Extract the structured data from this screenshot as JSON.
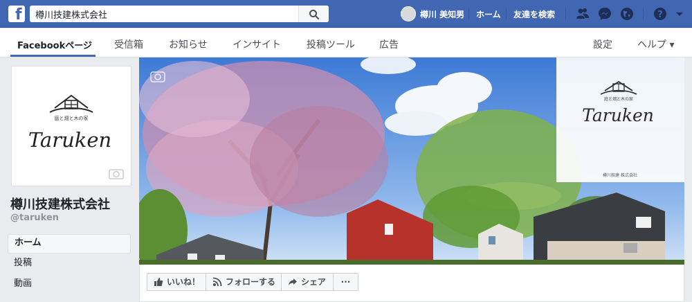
{
  "topbar": {
    "logo": "f",
    "search": {
      "value": "樽川技建株式会社",
      "placeholder": ""
    },
    "profile_name": "樽川 美知男",
    "home_label": "ホーム",
    "find_friends_label": "友達を検索",
    "icons": [
      "friend-requests-icon",
      "messenger-icon",
      "notifications-globe-icon",
      "help-icon",
      "dropdown-arrow-icon"
    ]
  },
  "pagenav": {
    "tabs": [
      {
        "label": "Facebookページ",
        "active": true
      },
      {
        "label": "受信箱"
      },
      {
        "label": "お知らせ"
      },
      {
        "label": "インサイト"
      },
      {
        "label": "投稿ツール"
      },
      {
        "label": "広告"
      }
    ],
    "settings_label": "設定",
    "help_label": "ヘルプ ▾"
  },
  "page": {
    "name": "樽川技建株式会社",
    "handle": "@taruken",
    "logo_tagline": "庭と畑と木の家",
    "logo_text": "Taruken",
    "cover_logo_caption": "樽川技建 株式会社"
  },
  "sidebar": {
    "items": [
      {
        "label": "ホーム",
        "active": true
      },
      {
        "label": "投稿"
      },
      {
        "label": "動画"
      }
    ]
  },
  "actions": {
    "like": "いいね！",
    "follow": "フォローする",
    "share": "シェア",
    "more": "···"
  },
  "colors": {
    "brand_blue": "#4267b2",
    "page_bg": "#e9ebee"
  }
}
